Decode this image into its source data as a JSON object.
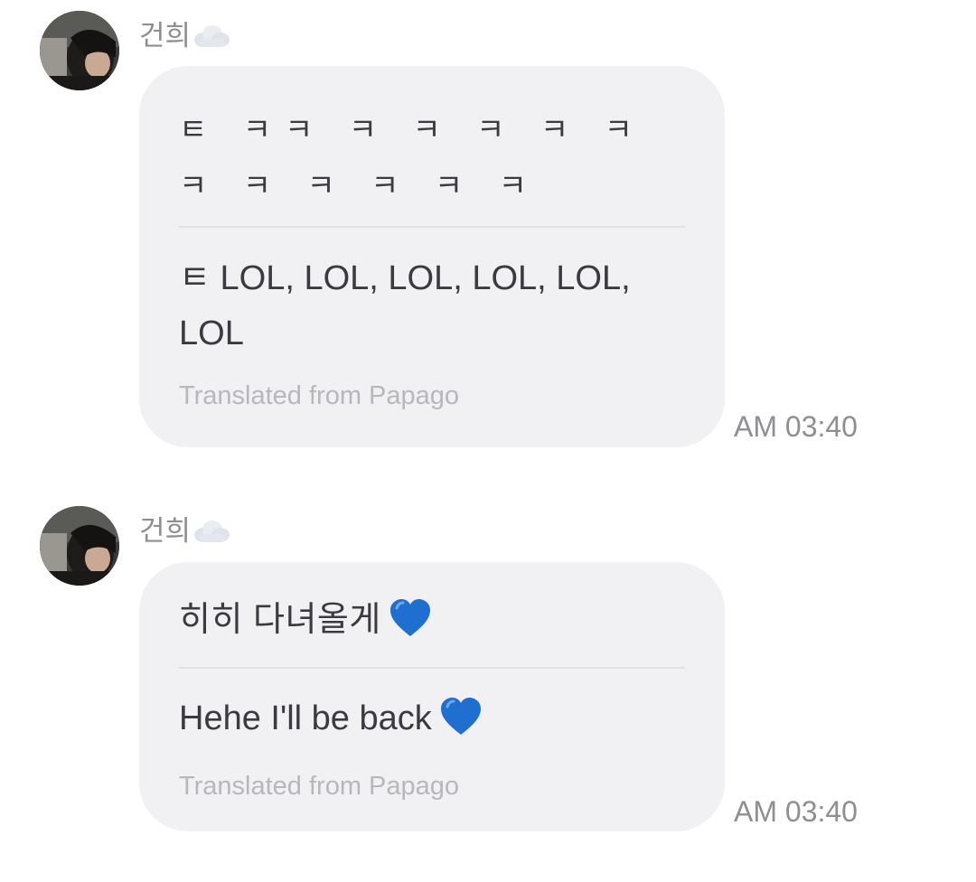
{
  "messages": [
    {
      "sender": "건희",
      "sender_emoji": "cloud-icon",
      "original": "ㅌ ㅋㅋ ㅋ ㅋ ㅋ ㅋ ㅋㅋ ㅋ ㅋ ㅋ ㅋ ㅋ",
      "translation": "ㅌ LOL, LOL, LOL, LOL, LOL, LOL",
      "source_note": "Translated from Papago",
      "time": "AM 03:40"
    },
    {
      "sender": "건희",
      "sender_emoji": "cloud-icon",
      "original": "히히 다녀올게",
      "original_emoji": "blue-heart-icon",
      "translation": "Hehe I'll be back",
      "translation_emoji": "blue-heart-icon",
      "source_note": "Translated from Papago",
      "time": "AM 03:40"
    }
  ],
  "colors": {
    "bubble": "#f1f1f4",
    "divider": "#e2e2e6",
    "text": "#3a3a40",
    "muted": "#8e8e93",
    "note": "#b7b7bd",
    "heart": "#1f6fd1"
  }
}
